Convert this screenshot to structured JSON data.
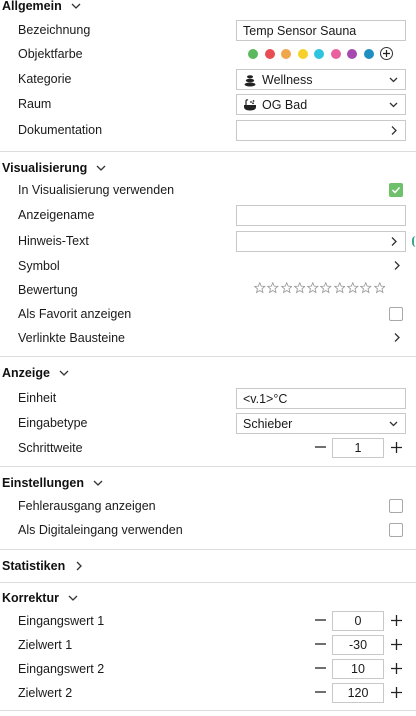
{
  "allgemein": {
    "title": "Allgemein",
    "bezeichnung_label": "Bezeichnung",
    "bezeichnung_value": "Temp Sensor Sauna",
    "objektfarbe_label": "Objektfarbe",
    "colors": [
      "#5cb85c",
      "#e84c55",
      "#f0a64a",
      "#f5d12a",
      "#2ec4e0",
      "#e860a0",
      "#a64ab0",
      "#1f8ec0"
    ],
    "kategorie_label": "Kategorie",
    "kategorie_value": "Wellness",
    "raum_label": "Raum",
    "raum_value": "OG Bad",
    "dokumentation_label": "Dokumentation"
  },
  "visualisierung": {
    "title": "Visualisierung",
    "in_vis_label": "In Visualisierung verwenden",
    "anzeigename_label": "Anzeigename",
    "hinweis_label": "Hinweis-Text",
    "symbol_label": "Symbol",
    "bewertung_label": "Bewertung",
    "rating": 0,
    "rating_max": 10,
    "favorit_label": "Als Favorit anzeigen",
    "verlinkte_label": "Verlinkte Bausteine"
  },
  "anzeige": {
    "title": "Anzeige",
    "einheit_label": "Einheit",
    "einheit_value": "<v.1>°C",
    "eingabetype_label": "Eingabetype",
    "eingabetype_value": "Schieber",
    "schrittweite_label": "Schrittweite",
    "schrittweite_value": "1"
  },
  "einstellungen": {
    "title": "Einstellungen",
    "fehlerausgang_label": "Fehlerausgang anzeigen",
    "digitaleingang_label": "Als Digitaleingang verwenden"
  },
  "statistiken": {
    "title": "Statistiken"
  },
  "korrektur": {
    "title": "Korrektur",
    "eingangswert1_label": "Eingangswert 1",
    "eingangswert1_value": "0",
    "zielwert1_label": "Zielwert 1",
    "zielwert1_value": "-30",
    "eingangswert2_label": "Eingangswert 2",
    "eingangswert2_value": "10",
    "zielwert2_label": "Zielwert 2",
    "zielwert2_value": "120"
  }
}
